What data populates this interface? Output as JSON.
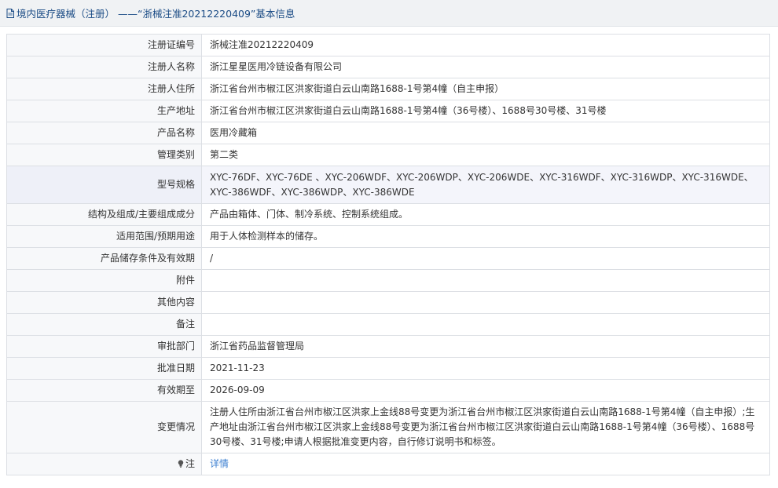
{
  "header": {
    "title": "境内医疗器械（注册） ——“浙械注准20212220409”基本信息",
    "icon": "document-icon"
  },
  "rows": [
    {
      "label": "注册证编号",
      "value": "浙械注准20212220409"
    },
    {
      "label": "注册人名称",
      "value": "浙江星星医用冷链设备有限公司"
    },
    {
      "label": "注册人住所",
      "value": "浙江省台州市椒江区洪家街道白云山南路1688-1号第4幢（自主申报）"
    },
    {
      "label": "生产地址",
      "value": "浙江省台州市椒江区洪家街道白云山南路1688-1号第4幢（36号楼）、1688号30号楼、31号楼"
    },
    {
      "label": "产品名称",
      "value": "医用冷藏箱"
    },
    {
      "label": "管理类别",
      "value": "第二类"
    },
    {
      "label": "型号规格",
      "value": "XYC-76DF、XYC-76DE 、XYC-206WDF、XYC-206WDP、XYC-206WDE、XYC-316WDF、XYC-316WDP、XYC-316WDE、XYC-386WDF、XYC-386WDP、XYC-386WDE"
    },
    {
      "label": "结构及组成/主要组成成分",
      "value": "产品由箱体、门体、制冷系统、控制系统组成。"
    },
    {
      "label": "适用范围/预期用途",
      "value": "用于人体检测样本的储存。"
    },
    {
      "label": "产品储存条件及有效期",
      "value": "/"
    },
    {
      "label": "附件",
      "value": ""
    },
    {
      "label": "其他内容",
      "value": ""
    },
    {
      "label": "备注",
      "value": ""
    },
    {
      "label": "审批部门",
      "value": "浙江省药品监督管理局"
    },
    {
      "label": "批准日期",
      "value": "2021-11-23"
    },
    {
      "label": "有效期至",
      "value": "2026-09-09"
    },
    {
      "label": "变更情况",
      "value": "注册人住所由浙江省台州市椒江区洪家上金线88号变更为浙江省台州市椒江区洪家街道白云山南路1688-1号第4幢（自主申报）;生产地址由浙江省台州市椒江区洪家上金线88号变更为浙江省台州市椒江区洪家街道白云山南路1688-1号第4幢（36号楼）、1688号30号楼、31号楼;申请人根据批准变更内容，自行修订说明书和标签。"
    }
  ],
  "note_row": {
    "label": "注",
    "icon": "lightbulb-icon",
    "link_text": "详情"
  },
  "colors": {
    "header_bg": "#f0f2f4",
    "title_color": "#1a4b85",
    "label_bg": "#f7f8fa",
    "alt_row_bg": "#f4f5fb",
    "border": "#dcdfe4",
    "link_color": "#3b7fd1"
  }
}
